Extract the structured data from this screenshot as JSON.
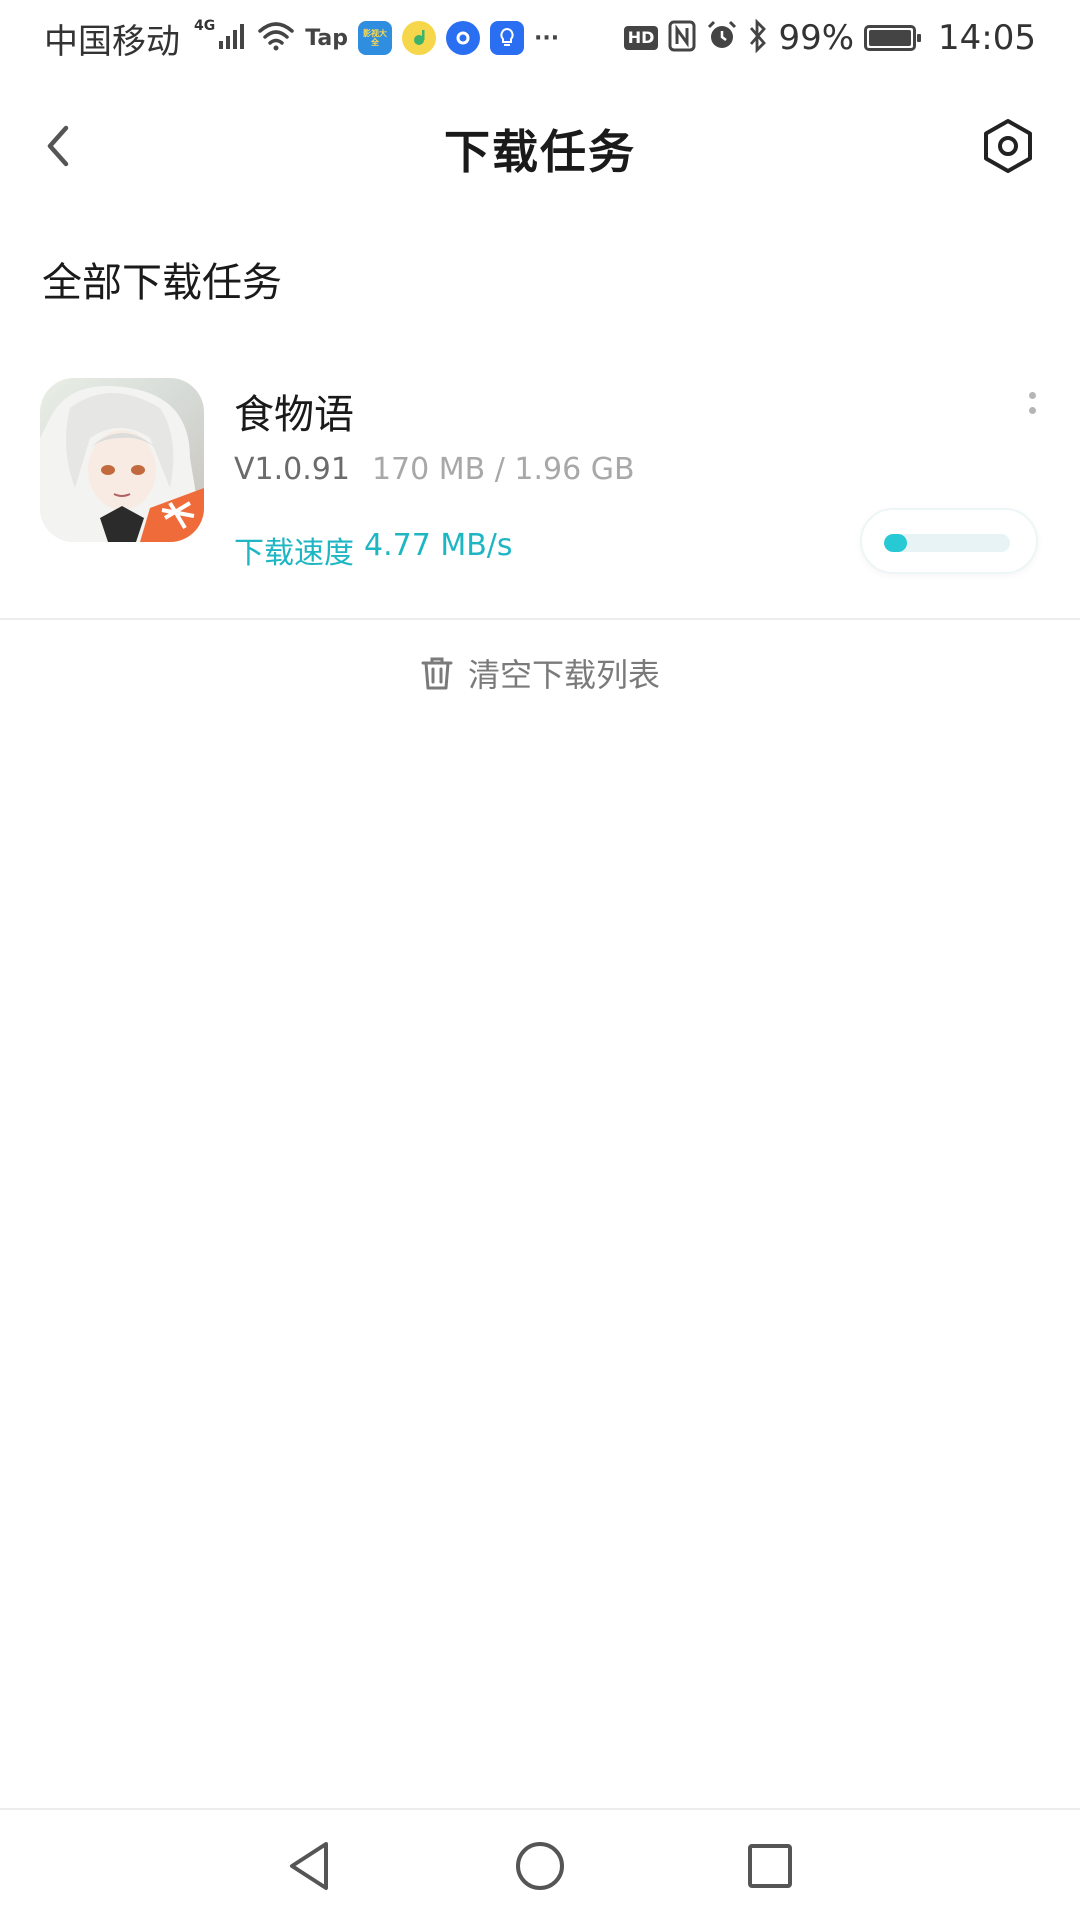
{
  "status_bar": {
    "carrier": "中国移动",
    "network_type": "4G",
    "tap_label": "Tap",
    "app_badge_label": "影视大全",
    "hd_label": "HD",
    "battery_percent": "99%",
    "battery_level": 0.99,
    "time": "14:05"
  },
  "header": {
    "title": "下载任务"
  },
  "section": {
    "title": "全部下载任务"
  },
  "downloads": [
    {
      "name": "食物语",
      "version": "V1.0.91",
      "size_progress": "170 MB / 1.96 GB",
      "speed_label": "下载速度",
      "speed_value": "4.77 MB/s",
      "progress_fraction": 0.087
    }
  ],
  "actions": {
    "clear_list_label": "清空下载列表"
  },
  "colors": {
    "accent": "#1fb6c4",
    "progress_fill": "#27c9d5"
  },
  "icons": {
    "back": "chevron-left-icon",
    "settings": "hexagon-settings-icon",
    "more": "vertical-dots-icon",
    "trash": "trash-icon"
  }
}
